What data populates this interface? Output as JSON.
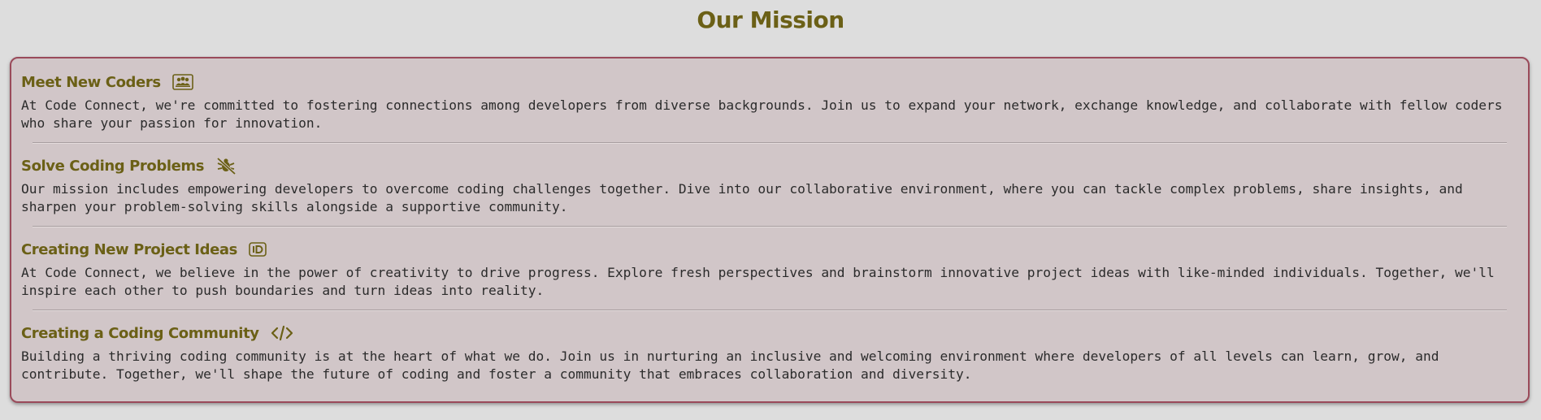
{
  "page": {
    "title": "Our Mission"
  },
  "sections": [
    {
      "title": "Meet New Coders",
      "icon": "people-group-icon",
      "body": "At Code Connect, we're committed to fostering connections among developers from diverse backgrounds. Join us to expand your network, exchange knowledge, and collaborate with fellow coders who share your passion for innovation."
    },
    {
      "title": "Solve Coding Problems",
      "icon": "bug-slash-icon",
      "body": "Our mission includes empowering developers to overcome coding challenges together. Dive into our collaborative environment, where you can tackle complex problems, share insights, and sharpen your problem-solving skills alongside a supportive community."
    },
    {
      "title": "Creating New Project Ideas",
      "icon": "lightbulb-idea-icon",
      "body": "At Code Connect, we believe in the power of creativity to drive progress. Explore fresh perspectives and brainstorm innovative project ideas with like-minded individuals. Together, we'll inspire each other to push boundaries and turn ideas into reality."
    },
    {
      "title": "Creating a Coding Community",
      "icon": "code-icon",
      "body": "Building a thriving coding community is at the heart of what we do. Join us in nurturing an inclusive and welcoming environment where developers of all levels can learn, grow, and contribute. Together, we'll shape the future of coding and foster a community that embraces collaboration and diversity."
    }
  ],
  "colors": {
    "heading": "#6b6016",
    "card_background": "#d1c6c8",
    "card_border": "#9a4a5a",
    "page_background": "#dddddd"
  }
}
